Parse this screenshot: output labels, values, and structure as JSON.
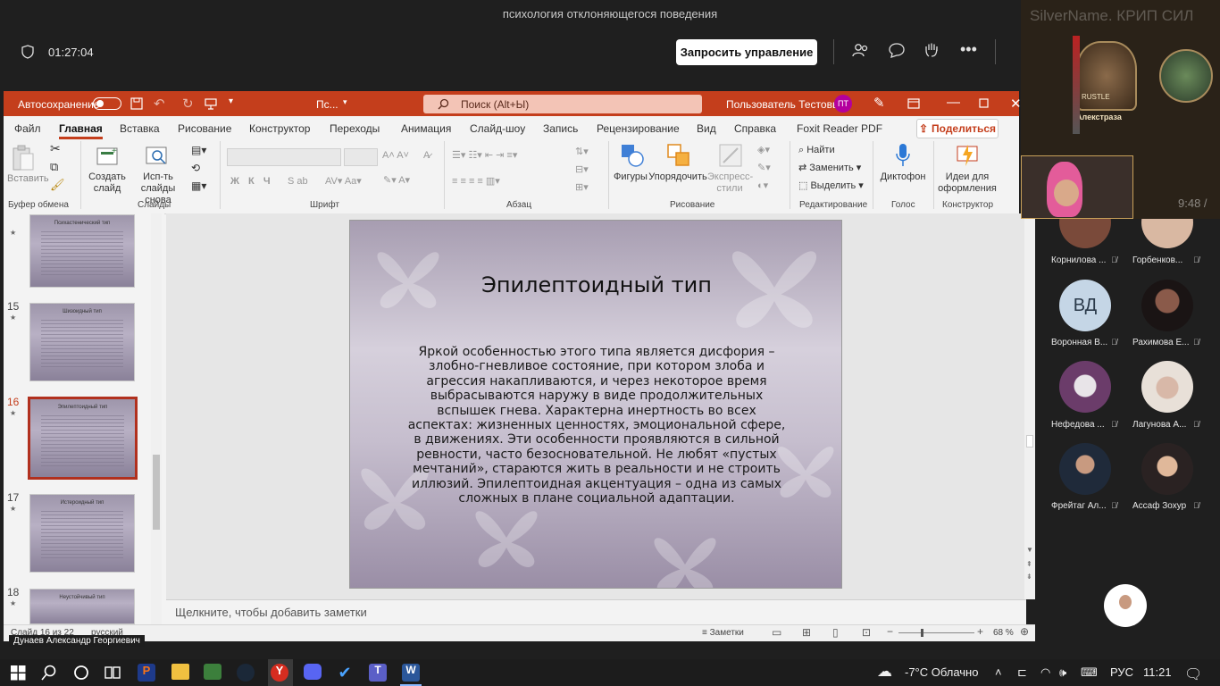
{
  "meeting": {
    "title": "психология отклоняющегося поведения",
    "timer": "01:27:04",
    "request_control_label": "Запросить управление"
  },
  "ppt": {
    "autosave_label": "Автосохранение",
    "doc_name": "Пс...",
    "search_placeholder": "Поиск (Alt+Ы)",
    "user_name": "Пользователь Тестовый",
    "user_initials": "ПТ",
    "menu": [
      "Файл",
      "Главная",
      "Вставка",
      "Рисование",
      "Конструктор",
      "Переходы",
      "Анимация",
      "Слайд-шоу",
      "Запись",
      "Рецензирование",
      "Вид",
      "Справка",
      "Foxit Reader PDF"
    ],
    "share_label": "Поделиться",
    "ribbon": {
      "paste": "Вставить",
      "new_slide": "Создать слайд",
      "reuse_slides": "Исп-ть слайды снова",
      "shapes": "Фигуры",
      "arrange": "Упорядочить",
      "quick_styles": "Экспресс-стили",
      "find": "Найти",
      "replace": "Заменить",
      "select": "Выделить",
      "dictate": "Диктофон",
      "design_ideas": "Идеи для оформления",
      "groups": {
        "clipboard": "Буфер обмена",
        "slides": "Слайды",
        "font": "Шрифт",
        "paragraph": "Абзац",
        "drawing": "Рисование",
        "editing": "Редактирование",
        "voice": "Голос",
        "designer": "Конструктор"
      }
    },
    "thumbs": [
      {
        "num": "",
        "title": "Психастенический тип"
      },
      {
        "num": "15",
        "title": "Шизоидный тип"
      },
      {
        "num": "16",
        "title": "Эпилептоидный тип"
      },
      {
        "num": "17",
        "title": "Истероидный тип"
      },
      {
        "num": "18",
        "title": "Неустойчивый тип"
      }
    ],
    "slide": {
      "title": "Эпилептоидный тип",
      "body": "Яркой особенностью этого типа является дисфория – злобно-гневливое состояние, при котором злоба и агрессия накапливаются, и через некоторое время выбрасываются наружу в виде продолжительных вспышек гнева. Характерна инертность во всех аспектах: жизненных ценностях, эмоциональной сфере, в движениях. Эти особенности проявляются в сильной ревности, часто безосновательной. Не любят «пустых мечтаний», стараются жить в реальности и не строить иллюзий. Эпилептоидная акцентуация – одна из самых сложных в плане социальной адаптации."
    },
    "notes_placeholder": "Щелкните, чтобы добавить заметки",
    "status": {
      "slide_counter": "Слайд 16 из 22",
      "language": "русский",
      "notes_label": "Заметки",
      "zoom": "68 %"
    }
  },
  "presenter_name": "Дунаев Александр Георгиевич",
  "overlay": {
    "stream_text": "SilverName. КРИП СИЛ",
    "card_name": "Алекстраза",
    "card_label": "RUSTLE",
    "clock": "9:48 /"
  },
  "participants": [
    {
      "name": "Корнилова ...",
      "color": "#7a4a3a"
    },
    {
      "name": "Горбенков...",
      "color": "#d9b8a2"
    },
    {
      "name": "Воронная В...",
      "initials": "ВД",
      "color": "#c5d6e6"
    },
    {
      "name": "Рахимова Е...",
      "color": "#5a2a2a"
    },
    {
      "name": "Нефедова ...",
      "color": "#6b3c6a"
    },
    {
      "name": "Лагунова А...",
      "color": "#8a7a6a"
    },
    {
      "name": "Фрейтаг Ал...",
      "color": "#3c5a4a"
    },
    {
      "name": "Ассаф Зохур",
      "color": "#2a2a2a"
    }
  ],
  "taskbar": {
    "weather": "-7°C  Облачно",
    "language": "РУС",
    "time": "11:21"
  }
}
